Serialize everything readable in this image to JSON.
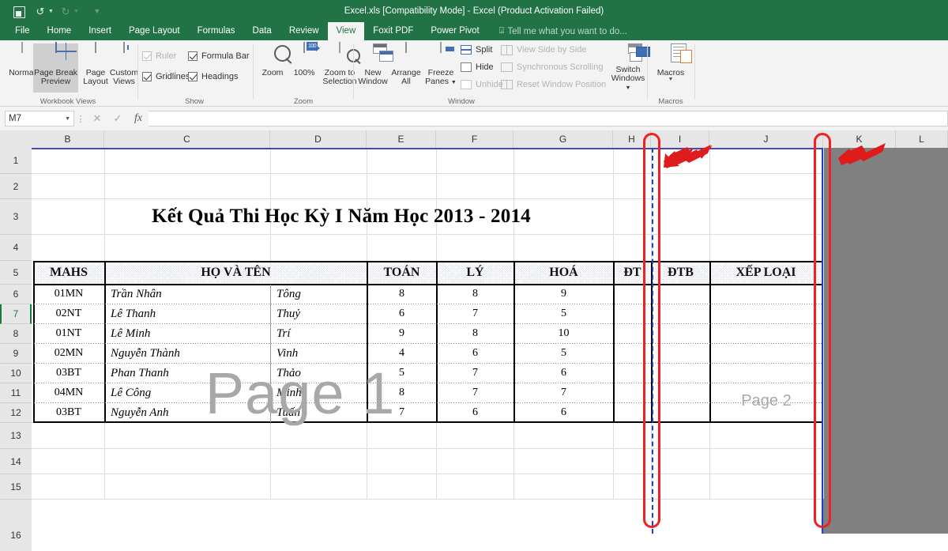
{
  "window": {
    "title": "Excel.xls  [Compatibility Mode] - Excel (Product Activation Failed)",
    "qat": {
      "save": "Save",
      "undo": "Undo",
      "redo": "Redo",
      "customize": "Customize Quick Access Toolbar"
    }
  },
  "ribbon": {
    "tabs": [
      {
        "label": "File",
        "active": false
      },
      {
        "label": "Home",
        "active": false
      },
      {
        "label": "Insert",
        "active": false
      },
      {
        "label": "Page Layout",
        "active": false
      },
      {
        "label": "Formulas",
        "active": false
      },
      {
        "label": "Data",
        "active": false
      },
      {
        "label": "Review",
        "active": false
      },
      {
        "label": "View",
        "active": true
      },
      {
        "label": "Foxit PDF",
        "active": false
      },
      {
        "label": "Power Pivot",
        "active": false
      }
    ],
    "tellme": "Tell me what you want to do...",
    "groups": {
      "workbook_views": {
        "label": "Workbook Views",
        "buttons": [
          {
            "label": "Normal",
            "selected": false
          },
          {
            "label": "Page Break Preview",
            "selected": true
          },
          {
            "label": "Page Layout",
            "selected": false
          },
          {
            "label": "Custom Views",
            "selected": false
          }
        ]
      },
      "show": {
        "label": "Show",
        "checks": [
          {
            "label": "Ruler",
            "checked": true,
            "enabled": false
          },
          {
            "label": "Formula Bar",
            "checked": true,
            "enabled": true
          },
          {
            "label": "Gridlines",
            "checked": true,
            "enabled": true
          },
          {
            "label": "Headings",
            "checked": true,
            "enabled": true
          }
        ]
      },
      "zoom": {
        "label": "Zoom",
        "buttons": [
          {
            "label": "Zoom"
          },
          {
            "label": "100%"
          },
          {
            "label": "Zoom to Selection"
          }
        ]
      },
      "window": {
        "label": "Window",
        "buttons": [
          {
            "label": "New Window"
          },
          {
            "label": "Arrange All"
          },
          {
            "label": "Freeze Panes"
          }
        ],
        "items": [
          {
            "label": "Split",
            "enabled": true
          },
          {
            "label": "Hide",
            "enabled": true
          },
          {
            "label": "Unhide",
            "enabled": false
          },
          {
            "label": "View Side by Side",
            "enabled": false
          },
          {
            "label": "Synchronous Scrolling",
            "enabled": false
          },
          {
            "label": "Reset Window Position",
            "enabled": false
          }
        ],
        "switch_windows": "Switch Windows"
      },
      "macros": {
        "label": "Macros",
        "button": "Macros"
      }
    }
  },
  "formula_bar": {
    "name_box": "M7",
    "formula": "",
    "cancel": "Cancel",
    "enter": "Enter",
    "insert_function": "fx"
  },
  "grid": {
    "column_headers": [
      "B",
      "C",
      "D",
      "E",
      "F",
      "G",
      "H",
      "I",
      "J",
      "K",
      "L"
    ],
    "row_headers": [
      "1",
      "2",
      "3",
      "4",
      "5",
      "6",
      "7",
      "8",
      "9",
      "10",
      "11",
      "12",
      "13",
      "14",
      "15",
      "16"
    ],
    "active_cell": "M7",
    "page_watermarks": [
      {
        "label": "Page 1"
      },
      {
        "label": "Page 2"
      }
    ]
  },
  "sheet": {
    "title": "Kết Quả Thi Học Kỳ I Năm Học 2013 - 2014",
    "headers": [
      "MAHS",
      "HỌ VÀ TÊN",
      "TOÁN",
      "LÝ",
      "HOÁ",
      "ĐT",
      "ĐTB",
      "XẾP LOẠI"
    ],
    "rows": [
      {
        "mahs": "01MN",
        "ho": "Trần Nhân",
        "ten": "Tông",
        "toan": "8",
        "ly": "8",
        "hoa": "9",
        "dt": "",
        "dtb": "",
        "xeploai": ""
      },
      {
        "mahs": "02NT",
        "ho": "Lê Thanh",
        "ten": "Thuỷ",
        "toan": "6",
        "ly": "7",
        "hoa": "5",
        "dt": "",
        "dtb": "",
        "xeploai": ""
      },
      {
        "mahs": "01NT",
        "ho": "Lê Minh",
        "ten": "Trí",
        "toan": "9",
        "ly": "8",
        "hoa": "10",
        "dt": "",
        "dtb": "",
        "xeploai": ""
      },
      {
        "mahs": "02MN",
        "ho": "Nguyễn Thành",
        "ten": "Vinh",
        "toan": "4",
        "ly": "6",
        "hoa": "5",
        "dt": "",
        "dtb": "",
        "xeploai": ""
      },
      {
        "mahs": "03BT",
        "ho": "Phan Thanh",
        "ten": "Thảo",
        "toan": "5",
        "ly": "7",
        "hoa": "6",
        "dt": "",
        "dtb": "",
        "xeploai": ""
      },
      {
        "mahs": "04MN",
        "ho": "Lê Công",
        "ten": "Minh",
        "toan": "8",
        "ly": "7",
        "hoa": "7",
        "dt": "",
        "dtb": "",
        "xeploai": ""
      },
      {
        "mahs": "03BT",
        "ho": "Nguyễn Anh",
        "ten": "Tuấn",
        "toan": "7",
        "ly": "6",
        "hoa": "6",
        "dt": "",
        "dtb": "",
        "xeploai": ""
      }
    ]
  },
  "annotations": {
    "highlight_color": "#ee2222",
    "page_break_line_color": "#1f3fd0",
    "items": [
      {
        "name": "dashed-page-break-highlight",
        "kind": "rounded-outline"
      },
      {
        "name": "solid-print-area-edge-highlight",
        "kind": "rounded-outline"
      },
      {
        "name": "arrow-to-dashed-break",
        "kind": "arrow"
      },
      {
        "name": "arrow-to-solid-edge",
        "kind": "arrow"
      }
    ]
  },
  "colors": {
    "excel_green": "#217346",
    "ribbon_bg": "#f3f3f3",
    "grid_outside": "#808080",
    "header_fill": "#d7dbe6"
  }
}
